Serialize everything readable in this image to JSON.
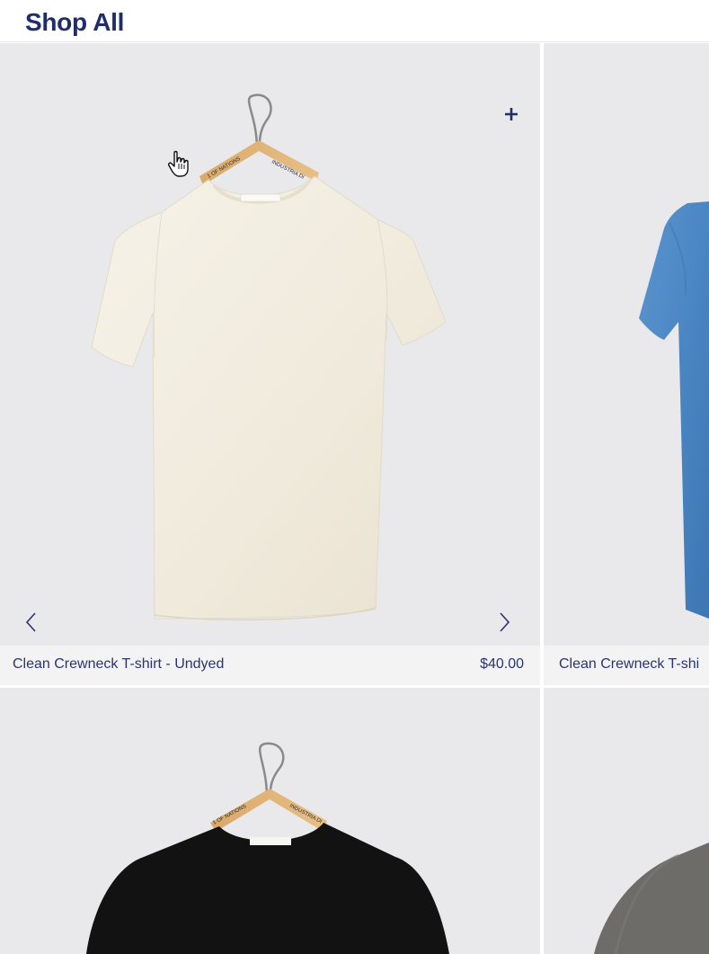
{
  "page": {
    "title": "Shop All"
  },
  "products": [
    {
      "name": "Clean Crewneck T-shirt - Undyed",
      "price": "$40.00",
      "color": "#f1ece0",
      "image_icon": "white-tshirt-on-hanger"
    },
    {
      "name": "Clean Crewneck T-shi",
      "color": "#4a86c3",
      "image_icon": "blue-tshirt-on-hanger"
    },
    {
      "color": "#111111",
      "image_icon": "black-tshirt-on-hanger"
    },
    {
      "color": "#6d6c69",
      "image_icon": "grey-tshirt"
    }
  ],
  "hanger_text": {
    "left": "1 OF NATIONS",
    "right": "INDUSTRIA DI"
  },
  "icons": {
    "add": "plus-icon",
    "prev": "chevron-left-icon",
    "next": "chevron-right-icon",
    "cursor": "hand-pointer-icon"
  },
  "colors": {
    "accent": "#1f2d6b",
    "card_bg": "#e9e9ec",
    "info_bg": "#f3f3f4"
  }
}
